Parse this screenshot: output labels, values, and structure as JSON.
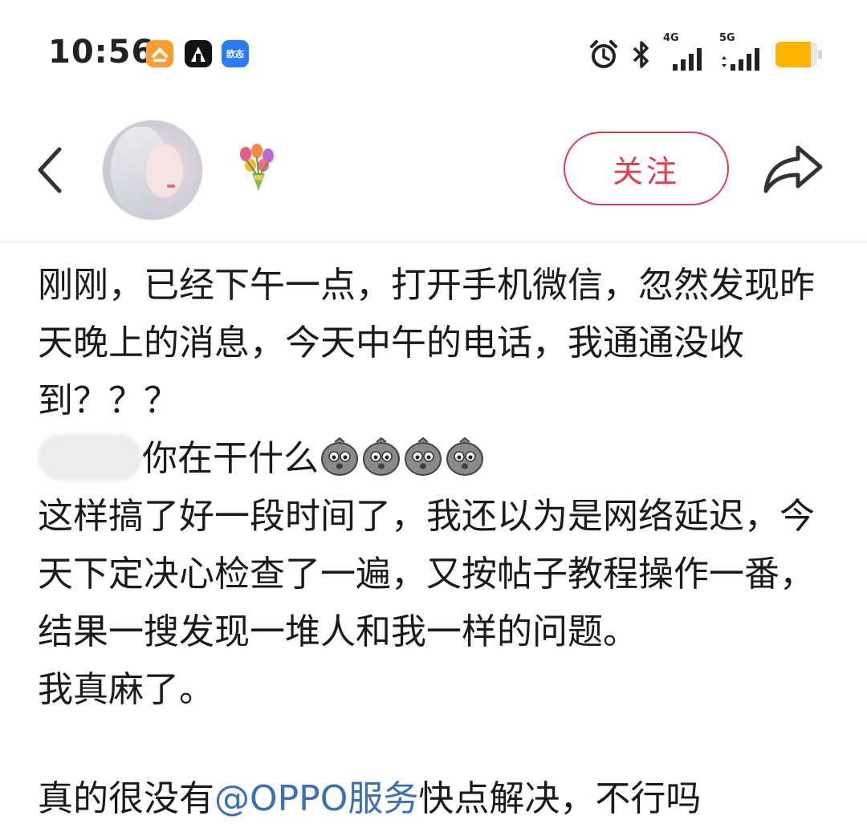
{
  "status_bar": {
    "time": "10:56",
    "app_icons": [
      "taobao-icon",
      "app-icon",
      "oppo-icon"
    ],
    "app_icon_3_label": "欧态",
    "network_1": "4G",
    "network_2": "5G",
    "battery_level": 0.85
  },
  "header": {
    "follow_label": "关注",
    "avatar": "user-avatar",
    "decoration": "flower-bouquet-emoji"
  },
  "post": {
    "paragraph_1": "刚刚，已经下午一点，打开手机微信，忽然发现昨天晚上的消息，今天中午的电话，我通通没收到？？？",
    "mention_text": "你在干什么",
    "emoji_count": 4,
    "paragraph_3": "这样搞了好一段时间了，我还以为是网络延迟，今天下定决心检查了一遍，又按帖子教程操作一番，结果一搜发现一堆人和我一样的问题。",
    "paragraph_4": "我真麻了。",
    "paragraph_5_prefix": "真的很没有",
    "paragraph_5_link": "@OPPO服务",
    "paragraph_5_suffix": "快点解决，不行吗"
  },
  "colors": {
    "accent": "#e53b4a",
    "link": "#3b6fb6",
    "battery": "#ffb400"
  }
}
